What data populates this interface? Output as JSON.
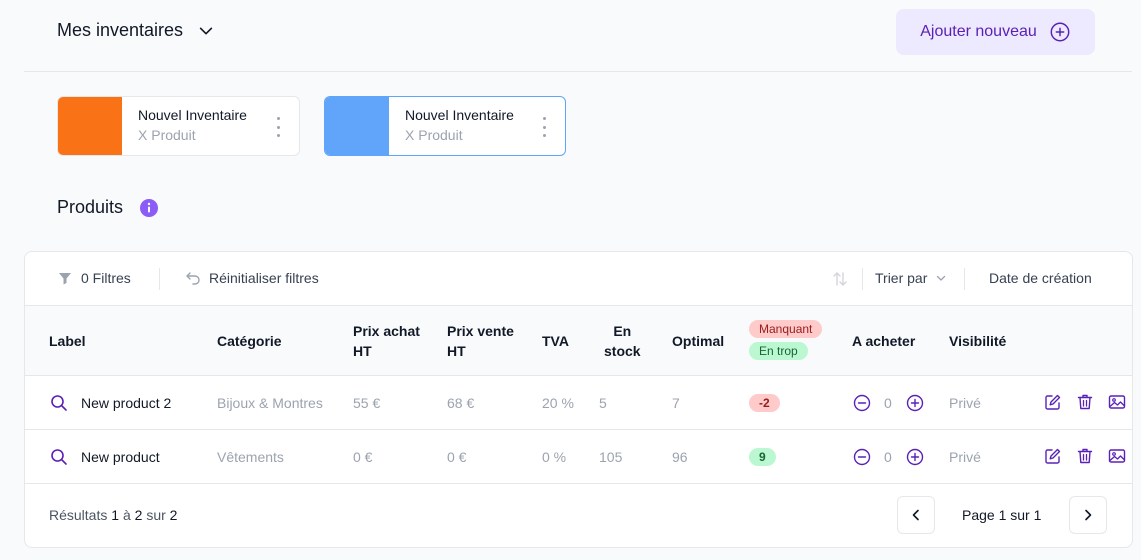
{
  "header": {
    "title": "Mes inventaires",
    "add_label": "Ajouter nouveau"
  },
  "inventories": [
    {
      "name": "Nouvel Inventaire",
      "sub": "X Produit",
      "color": "#f97316"
    },
    {
      "name": "Nouvel Inventaire",
      "sub": "X Produit",
      "color": "#60a5fa"
    }
  ],
  "products": {
    "title": "Produits",
    "toolbar": {
      "filters": "0 Filtres",
      "reset": "Réinitialiser filtres",
      "sort_by": "Trier par",
      "sort_value": "Date de création"
    },
    "columns": {
      "label": "Label",
      "category": "Catégorie",
      "buy_line1": "Prix achat",
      "buy_line2": "HT",
      "sell_line1": "Prix vente",
      "sell_line2": "HT",
      "tva": "TVA",
      "stock_line1": "En",
      "stock_line2": "stock",
      "optimal": "Optimal",
      "missing_badge": "Manquant",
      "surplus_badge": "En trop",
      "to_buy": "A acheter",
      "visibility": "Visibilité"
    },
    "rows": [
      {
        "label": "New product 2",
        "category": "Bijoux & Montres",
        "buy": "55 €",
        "sell": "68 €",
        "tva": "20 %",
        "stock": "5",
        "optimal": "7",
        "diff": "-2",
        "diff_type": "red",
        "to_buy": "0",
        "visibility": "Privé"
      },
      {
        "label": "New product",
        "category": "Vêtements",
        "buy": "0 €",
        "sell": "0 €",
        "tva": "0 %",
        "stock": "105",
        "optimal": "96",
        "diff": "9",
        "diff_type": "green",
        "to_buy": "0",
        "visibility": "Privé"
      }
    ],
    "footer": {
      "results_prefix": "Résultats",
      "from": "1",
      "to_word": "à",
      "to": "2",
      "of_word": "sur",
      "total": "2",
      "page_text": "Page 1 sur 1"
    }
  },
  "colors": {
    "accent": "#5b21b6",
    "accent_bg": "#ede9fe",
    "info_icon": "#8b5cf6"
  }
}
